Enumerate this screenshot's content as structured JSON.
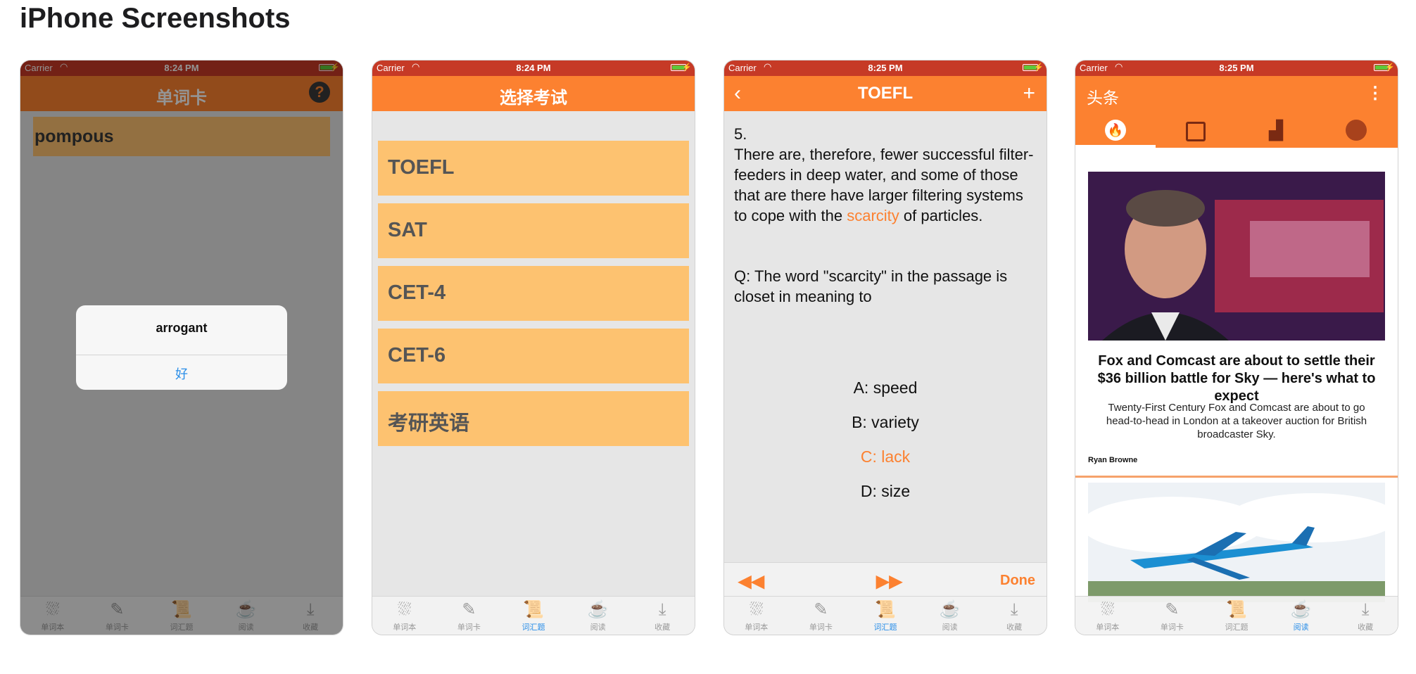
{
  "page_title": "iPhone Screenshots",
  "status": {
    "carrier": "Carrier",
    "time1": "8:24 PM",
    "time2": "8:24 PM",
    "time3": "8:25 PM",
    "time4": "8:25 PM"
  },
  "tabs": {
    "t1": "单词本",
    "t2": "单词卡",
    "t3": "词汇题",
    "t4": "阅读",
    "t5": "收藏"
  },
  "screen1": {
    "title": "单词卡",
    "help_icon": "question-icon",
    "word": "pompous",
    "alert_message": "arrogant",
    "alert_ok": "好"
  },
  "screen2": {
    "title": "选择考试",
    "exams": [
      "TOEFL",
      "SAT",
      "CET-4",
      "CET-6",
      "考研英语"
    ]
  },
  "screen3": {
    "title": "TOEFL",
    "number": "5.",
    "passage_before": "There are, therefore, fewer successful filter-feeders in deep water, and some of those that are there have larger filtering systems to cope with the",
    "passage_highlight": "scarcity",
    "passage_after": "of particles.",
    "question": "Q: The word \"scarcity\" in the passage is closet in meaning to",
    "options": [
      "A: speed",
      "B: variety",
      "C: lack",
      "D: size"
    ],
    "selected_option": "C: lack",
    "done": "Done"
  },
  "screen4": {
    "title": "头条",
    "headline": "Fox and Comcast are about to settle their $36 billion battle for Sky — here's what to expect",
    "summary": "Twenty-First Century Fox and Comcast are about to go head-to-head in London at a takeover auction for British broadcaster Sky.",
    "author": "Ryan Browne"
  },
  "colors": {
    "accent": "#fc8130",
    "status_bar": "#c63a26",
    "card": "#fdc270",
    "active_tab": "#2a8ee8"
  }
}
